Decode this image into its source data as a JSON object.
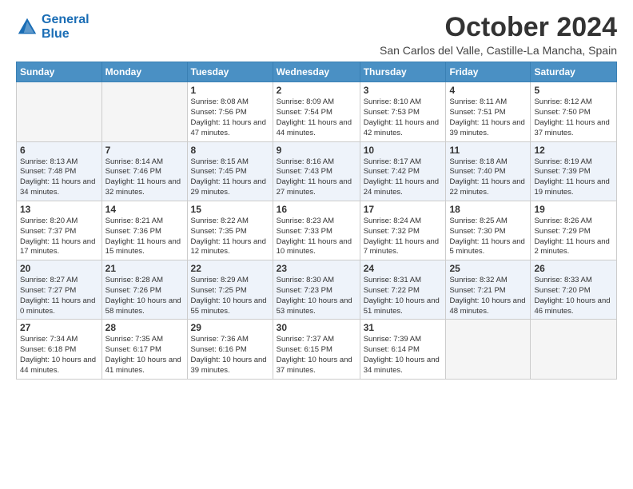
{
  "header": {
    "logo_line1": "General",
    "logo_line2": "Blue",
    "month": "October 2024",
    "location": "San Carlos del Valle, Castille-La Mancha, Spain"
  },
  "days_of_week": [
    "Sunday",
    "Monday",
    "Tuesday",
    "Wednesday",
    "Thursday",
    "Friday",
    "Saturday"
  ],
  "weeks": [
    [
      {
        "day": "",
        "info": ""
      },
      {
        "day": "",
        "info": ""
      },
      {
        "day": "1",
        "info": "Sunrise: 8:08 AM\nSunset: 7:56 PM\nDaylight: 11 hours and 47 minutes."
      },
      {
        "day": "2",
        "info": "Sunrise: 8:09 AM\nSunset: 7:54 PM\nDaylight: 11 hours and 44 minutes."
      },
      {
        "day": "3",
        "info": "Sunrise: 8:10 AM\nSunset: 7:53 PM\nDaylight: 11 hours and 42 minutes."
      },
      {
        "day": "4",
        "info": "Sunrise: 8:11 AM\nSunset: 7:51 PM\nDaylight: 11 hours and 39 minutes."
      },
      {
        "day": "5",
        "info": "Sunrise: 8:12 AM\nSunset: 7:50 PM\nDaylight: 11 hours and 37 minutes."
      }
    ],
    [
      {
        "day": "6",
        "info": "Sunrise: 8:13 AM\nSunset: 7:48 PM\nDaylight: 11 hours and 34 minutes."
      },
      {
        "day": "7",
        "info": "Sunrise: 8:14 AM\nSunset: 7:46 PM\nDaylight: 11 hours and 32 minutes."
      },
      {
        "day": "8",
        "info": "Sunrise: 8:15 AM\nSunset: 7:45 PM\nDaylight: 11 hours and 29 minutes."
      },
      {
        "day": "9",
        "info": "Sunrise: 8:16 AM\nSunset: 7:43 PM\nDaylight: 11 hours and 27 minutes."
      },
      {
        "day": "10",
        "info": "Sunrise: 8:17 AM\nSunset: 7:42 PM\nDaylight: 11 hours and 24 minutes."
      },
      {
        "day": "11",
        "info": "Sunrise: 8:18 AM\nSunset: 7:40 PM\nDaylight: 11 hours and 22 minutes."
      },
      {
        "day": "12",
        "info": "Sunrise: 8:19 AM\nSunset: 7:39 PM\nDaylight: 11 hours and 19 minutes."
      }
    ],
    [
      {
        "day": "13",
        "info": "Sunrise: 8:20 AM\nSunset: 7:37 PM\nDaylight: 11 hours and 17 minutes."
      },
      {
        "day": "14",
        "info": "Sunrise: 8:21 AM\nSunset: 7:36 PM\nDaylight: 11 hours and 15 minutes."
      },
      {
        "day": "15",
        "info": "Sunrise: 8:22 AM\nSunset: 7:35 PM\nDaylight: 11 hours and 12 minutes."
      },
      {
        "day": "16",
        "info": "Sunrise: 8:23 AM\nSunset: 7:33 PM\nDaylight: 11 hours and 10 minutes."
      },
      {
        "day": "17",
        "info": "Sunrise: 8:24 AM\nSunset: 7:32 PM\nDaylight: 11 hours and 7 minutes."
      },
      {
        "day": "18",
        "info": "Sunrise: 8:25 AM\nSunset: 7:30 PM\nDaylight: 11 hours and 5 minutes."
      },
      {
        "day": "19",
        "info": "Sunrise: 8:26 AM\nSunset: 7:29 PM\nDaylight: 11 hours and 2 minutes."
      }
    ],
    [
      {
        "day": "20",
        "info": "Sunrise: 8:27 AM\nSunset: 7:27 PM\nDaylight: 11 hours and 0 minutes."
      },
      {
        "day": "21",
        "info": "Sunrise: 8:28 AM\nSunset: 7:26 PM\nDaylight: 10 hours and 58 minutes."
      },
      {
        "day": "22",
        "info": "Sunrise: 8:29 AM\nSunset: 7:25 PM\nDaylight: 10 hours and 55 minutes."
      },
      {
        "day": "23",
        "info": "Sunrise: 8:30 AM\nSunset: 7:23 PM\nDaylight: 10 hours and 53 minutes."
      },
      {
        "day": "24",
        "info": "Sunrise: 8:31 AM\nSunset: 7:22 PM\nDaylight: 10 hours and 51 minutes."
      },
      {
        "day": "25",
        "info": "Sunrise: 8:32 AM\nSunset: 7:21 PM\nDaylight: 10 hours and 48 minutes."
      },
      {
        "day": "26",
        "info": "Sunrise: 8:33 AM\nSunset: 7:20 PM\nDaylight: 10 hours and 46 minutes."
      }
    ],
    [
      {
        "day": "27",
        "info": "Sunrise: 7:34 AM\nSunset: 6:18 PM\nDaylight: 10 hours and 44 minutes."
      },
      {
        "day": "28",
        "info": "Sunrise: 7:35 AM\nSunset: 6:17 PM\nDaylight: 10 hours and 41 minutes."
      },
      {
        "day": "29",
        "info": "Sunrise: 7:36 AM\nSunset: 6:16 PM\nDaylight: 10 hours and 39 minutes."
      },
      {
        "day": "30",
        "info": "Sunrise: 7:37 AM\nSunset: 6:15 PM\nDaylight: 10 hours and 37 minutes."
      },
      {
        "day": "31",
        "info": "Sunrise: 7:39 AM\nSunset: 6:14 PM\nDaylight: 10 hours and 34 minutes."
      },
      {
        "day": "",
        "info": ""
      },
      {
        "day": "",
        "info": ""
      }
    ]
  ]
}
